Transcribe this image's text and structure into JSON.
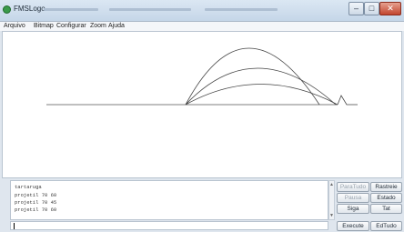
{
  "window": {
    "title": "FMSLogo",
    "buttons": {
      "minimize": "–",
      "maximize": "□",
      "close": "✕"
    }
  },
  "menu": [
    {
      "label": "Arquivo"
    },
    {
      "label": "Bitmap"
    },
    {
      "label": "Configurar"
    },
    {
      "label": "Zoom"
    },
    {
      "label": "Ajuda"
    }
  ],
  "output": {
    "lines": [
      "tartaruga",
      "projetil 70 60",
      "projetil 70 45",
      "projetil 70 60"
    ]
  },
  "command_input": {
    "value": ""
  },
  "controls": {
    "para_tudo": "ParaTudo",
    "rastreie": "Rastreie",
    "pausa": "Pausa",
    "estado": "Estado",
    "siga": "Siga",
    "tat": "Tat",
    "execute": "Execute",
    "edtudo": "EdTudo"
  },
  "icons": {
    "app": "turtle-icon",
    "scroll_up": "arrow-up-icon",
    "scroll_down": "arrow-down-icon"
  }
}
